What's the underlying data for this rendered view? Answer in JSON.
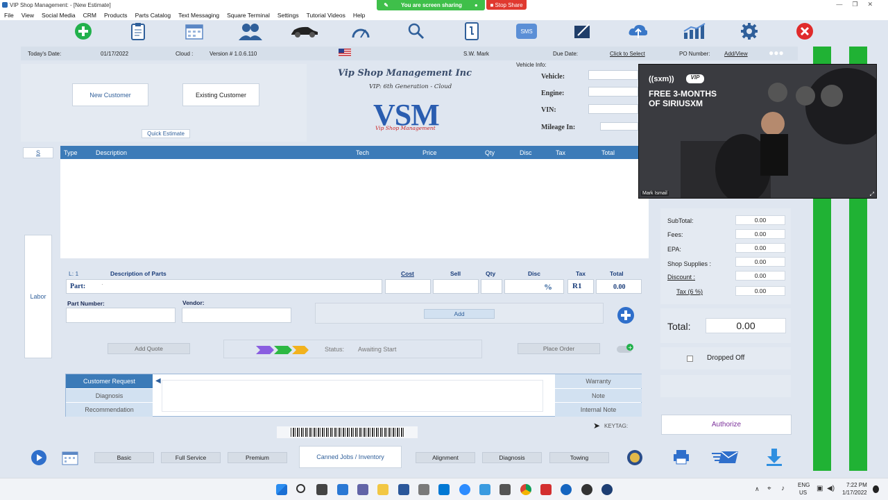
{
  "window": {
    "title": "VIP Shop Management:  - [New Estimate]"
  },
  "share": {
    "banner": "You are screen sharing",
    "stop": "Stop Share"
  },
  "menu": [
    "File",
    "View",
    "Social Media",
    "CRM",
    "Products",
    "Parts Catalog",
    "Text Messaging",
    "Square Terminal",
    "Settings",
    "Tutorial Videos",
    "Help"
  ],
  "toolbar_icons": [
    "add-icon",
    "clipboard-icon",
    "calendar-icon",
    "customers-icon",
    "car-icon",
    "speedometer-icon",
    "search-icon",
    "phone-icon",
    "sms-icon",
    "signature-icon",
    "cloud-upload-icon",
    "chart-icon",
    "gear-icon",
    "close-icon"
  ],
  "toolbar": {
    "sms_label": "SMS"
  },
  "info": {
    "date_label": "Today's Date:",
    "date": "01/17/2022",
    "cloud_label": "Cloud :",
    "version": "Version # 1.0.6.110",
    "user": "S.W.  Mark",
    "due_label": "Due Date:",
    "due_value": "Click to Select",
    "po_label": "PO Number:",
    "po_value": "Add/View"
  },
  "customer": {
    "new": "New Customer",
    "existing": "Existing Customer",
    "quick": "Quick Estimate"
  },
  "brand": {
    "name": "Vip Shop Management Inc",
    "tagline": "VIP: 6th Generation - Cloud",
    "logo": "VSM",
    "logo_sub": "Vip Shop Management"
  },
  "vehicle": {
    "header": "Vehicle Info:",
    "vehicle": "Vehicle:",
    "engine": "Engine:",
    "vin": "VIN:",
    "mileage": "Mileage In:"
  },
  "grid": {
    "tab": "S",
    "columns": [
      "Type",
      "Description",
      "Tech",
      "Price",
      "Qty",
      "Disc",
      "Tax",
      "Total"
    ]
  },
  "side": {
    "labor": "Labor"
  },
  "parts": {
    "line": "L: 1",
    "desc_header": "Description of Parts",
    "cost": "Cost",
    "sell": "Sell",
    "qty": "Qty",
    "disc": "Disc",
    "tax": "Tax",
    "total": "Total",
    "part_label": "Part:",
    "disc_unit": "%",
    "tax_value": "R1",
    "total_value": "0.00",
    "part_number": "Part Number:",
    "vendor": "Vendor:",
    "add": "Add"
  },
  "status": {
    "add_quote": "Add Quote",
    "label": "Status:",
    "value": "Awaiting Start",
    "place_order": "Place Order"
  },
  "notes": {
    "left": [
      "Customer Request",
      "Diagnosis",
      "Recommendation"
    ],
    "right": [
      "Warranty",
      "Note",
      "Internal Note"
    ],
    "keytag": "KEYTAG:"
  },
  "totals": {
    "rows": [
      {
        "label": "SubTotal:",
        "value": "0.00"
      },
      {
        "label": "Fees:",
        "value": "0.00"
      },
      {
        "label": "EPA:",
        "value": "0.00"
      },
      {
        "label": "Shop Supplies :",
        "value": "0.00"
      },
      {
        "label": "Discount :",
        "value": "0.00"
      },
      {
        "label": "Tax (6 %)",
        "value": "0.00"
      }
    ],
    "total_label": "Total:",
    "total_value": "0.00",
    "dropped_off": "Dropped Off",
    "authorize": "Authorize"
  },
  "bottom": {
    "tabs": [
      "Basic",
      "Full Service",
      "Premium",
      "Canned Jobs / Inventory",
      "Alignment",
      "Diagnosis",
      "Towing"
    ]
  },
  "video": {
    "brand": "((sxm))",
    "vip": "VIP",
    "headline1": "FREE 3-MONTHS",
    "headline2": "OF SIRIUSXM",
    "name": "Mark Ismail"
  },
  "taskbar": {
    "lang1": "ENG",
    "lang2": "US",
    "time": "7:22 PM",
    "date": "1/17/2022"
  }
}
